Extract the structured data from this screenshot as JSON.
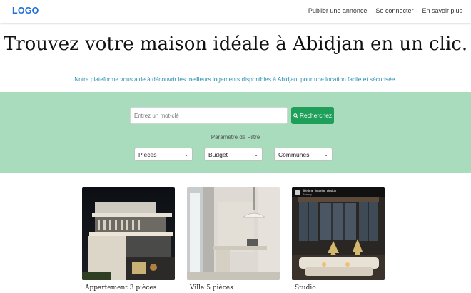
{
  "navbar": {
    "logo": "LOGO",
    "links": [
      "Publier une annonce",
      "Se connecter",
      "En savoir plus"
    ]
  },
  "hero": {
    "title": "Trouvez votre maison idéale à Abidjan en un clic.",
    "subtitle": "Notre plateforme vous aide à découvrir les meilleurs logements disponibles à Abidjan, pour une location facile et sécurisée."
  },
  "search": {
    "placeholder": "Entrez un mot-clé",
    "button_label": "Recherchez",
    "filter_label": "Paramètre de Filtre",
    "filters": [
      "Pièces",
      "Budget",
      "Communes"
    ]
  },
  "listings": [
    {
      "title": "Appartement 3 pièces"
    },
    {
      "title": "Villa 5 pièces"
    },
    {
      "title": "Studio",
      "overlay_user": "lifetime_interior_design",
      "overlay_sub": "Norway"
    }
  ],
  "colors": {
    "accent": "#1e6fd9",
    "band": "#a8dcbd",
    "button": "#1ea05a",
    "subtitle": "#2a8fb0"
  }
}
